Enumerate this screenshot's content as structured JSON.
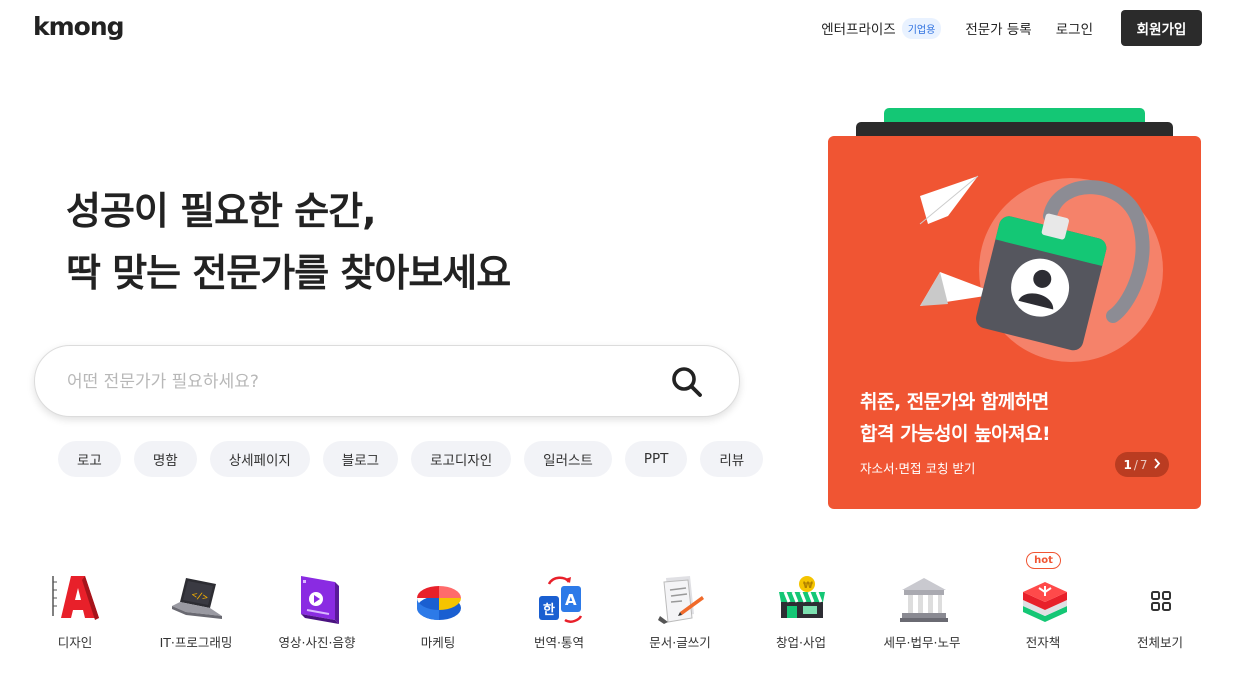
{
  "header": {
    "logo": "kmong",
    "nav": {
      "enterprise": "엔터프라이즈",
      "enterprise_badge": "기업용",
      "register_expert": "전문가 등록",
      "login": "로그인",
      "signup": "회원가입"
    }
  },
  "hero": {
    "title_line1": "성공이 필요한 순간,",
    "title_line2": "딱 맞는 전문가를 찾아보세요",
    "search_placeholder": "어떤 전문가가 필요하세요?",
    "search_icon": "search-icon",
    "tags": [
      "로고",
      "명함",
      "상세페이지",
      "블로그",
      "로고디자인",
      "일러스트",
      "PPT",
      "리뷰"
    ]
  },
  "banner": {
    "title_line1": "취준, 전문가와 함께하면",
    "title_line2": "합격 가능성이 높아져요!",
    "subtitle": "자소서·면접 코칭 받기",
    "pager_current": "1",
    "pager_sep": "/",
    "pager_total": "7",
    "pager_icon": "chevron-right-icon",
    "colors": {
      "background": "#f05533",
      "circle": "#f5826a",
      "green": "#14c775"
    }
  },
  "categories": [
    {
      "label": "디자인",
      "icon": "design-icon"
    },
    {
      "label": "IT·프로그래밍",
      "icon": "laptop-icon"
    },
    {
      "label": "영상·사진·음향",
      "icon": "video-icon"
    },
    {
      "label": "마케팅",
      "icon": "pie-chart-icon"
    },
    {
      "label": "번역·통역",
      "icon": "translate-icon"
    },
    {
      "label": "문서·글쓰기",
      "icon": "document-icon"
    },
    {
      "label": "창업·사업",
      "icon": "store-icon"
    },
    {
      "label": "세무·법무·노무",
      "icon": "building-icon"
    },
    {
      "label": "전자책",
      "icon": "book-icon",
      "badge": "hot"
    },
    {
      "label": "전체보기",
      "icon": "grid-icon"
    }
  ]
}
